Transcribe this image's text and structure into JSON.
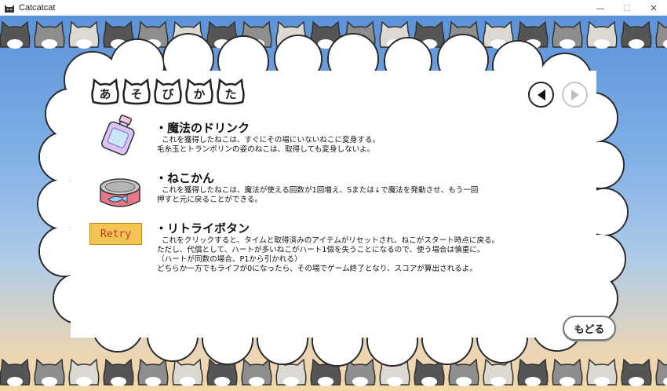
{
  "window": {
    "title": "Catcatcat",
    "controls": {
      "minimize": "—",
      "maximize": "☐",
      "close": "✕"
    }
  },
  "tabs": [
    "あ",
    "そ",
    "び",
    "か",
    "た"
  ],
  "nav": {
    "prev_icon": "triangle-left-icon",
    "next_icon": "triangle-right-icon",
    "next_enabled": false
  },
  "items": [
    {
      "icon": "potion-bottle-icon",
      "title": "・魔法のドリンク",
      "lines": [
        "これを獲得したねこは、すぐにその場にいないねこに変身する。",
        "毛糸玉とトランポリンの姿のねこは、取得しても変身しないよ。"
      ]
    },
    {
      "icon": "cat-food-can-icon",
      "title": "・ねこかん",
      "lines": [
        "これを獲得したねこは、魔法が使える回数が1回増え、Sまたは↓で魔法を発動させ、もう一回",
        "押すと元に戻ることができる。"
      ]
    },
    {
      "icon": "retry-button",
      "button_label": "Retry",
      "title": "・リトライボタン",
      "lines": [
        "これをクリックすると、タイムと取得済みのアイテムがリセットされ、ねこがスタート時点に戻る。",
        "ただし、代償として、ハートが多いねこがハート1個を失うことになるので、使う場合は慎重に。",
        "（ハートが同数の場合、P1から引かれる）",
        "どちらか一方でもライフが0になったら、その場でゲーム終了となり、スコアが算出されるよ。"
      ]
    }
  ],
  "back_label": "もどる",
  "colors": {
    "sky_top": "#5c92d9",
    "sand": "#f2d8a6",
    "retry_bg": "#f3c451",
    "retry_text": "#c0392b"
  },
  "cat_colors": [
    "#555555",
    "#8e8e8e",
    "#dcd8d2",
    "#555555",
    "#8e8e8e",
    "#dcd8d2"
  ]
}
